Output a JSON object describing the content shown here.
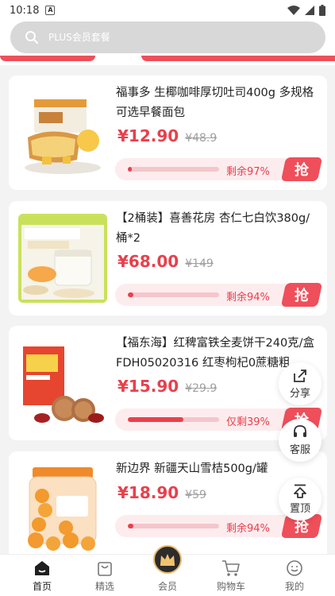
{
  "status_bar": {
    "time": "10:18",
    "notification_icon": "A"
  },
  "search": {
    "placeholder": "PLUS会员套餐"
  },
  "products": [
    {
      "title": "福事多 生椰咖啡厚切吐司400g 多规格可选早餐面包",
      "price": "¥12.90",
      "old_price": "¥48.9",
      "stock_text": "剩余97%",
      "stock_percent": 97,
      "sold_fraction": 0.03,
      "button": "抢"
    },
    {
      "title": "【2桶装】喜善花房 杏仁七白饮380g/桶*2",
      "price": "¥68.00",
      "old_price": "¥149",
      "stock_text": "剩余94%",
      "stock_percent": 94,
      "sold_fraction": 0.06,
      "button": "抢"
    },
    {
      "title": "【福东海】红稗富铁全麦饼干240克/盒FDH05020316 红枣枸杞0蔗糖粗",
      "price": "¥15.90",
      "old_price": "¥29.9",
      "stock_text": "仅剩39%",
      "stock_percent": 39,
      "sold_fraction": 0.61,
      "button": "抢"
    },
    {
      "title": "新边界 新疆天山雪桔500g/罐",
      "price": "¥18.90",
      "old_price": "¥59",
      "stock_text": "剩余94%",
      "stock_percent": 94,
      "sold_fraction": 0.06,
      "button": "抢"
    }
  ],
  "floating": {
    "share": "分享",
    "service": "客服",
    "top": "置顶"
  },
  "tabs": [
    {
      "label": "首页",
      "icon": "home-icon"
    },
    {
      "label": "精选",
      "icon": "bag-icon"
    },
    {
      "label": "会员",
      "icon": "crown-icon"
    },
    {
      "label": "购物车",
      "icon": "cart-icon"
    },
    {
      "label": "我的",
      "icon": "profile-icon"
    }
  ],
  "colors": {
    "accent": "#e8404c",
    "strip": "#ef4f5a",
    "search_bg": "#d8d8d8"
  }
}
